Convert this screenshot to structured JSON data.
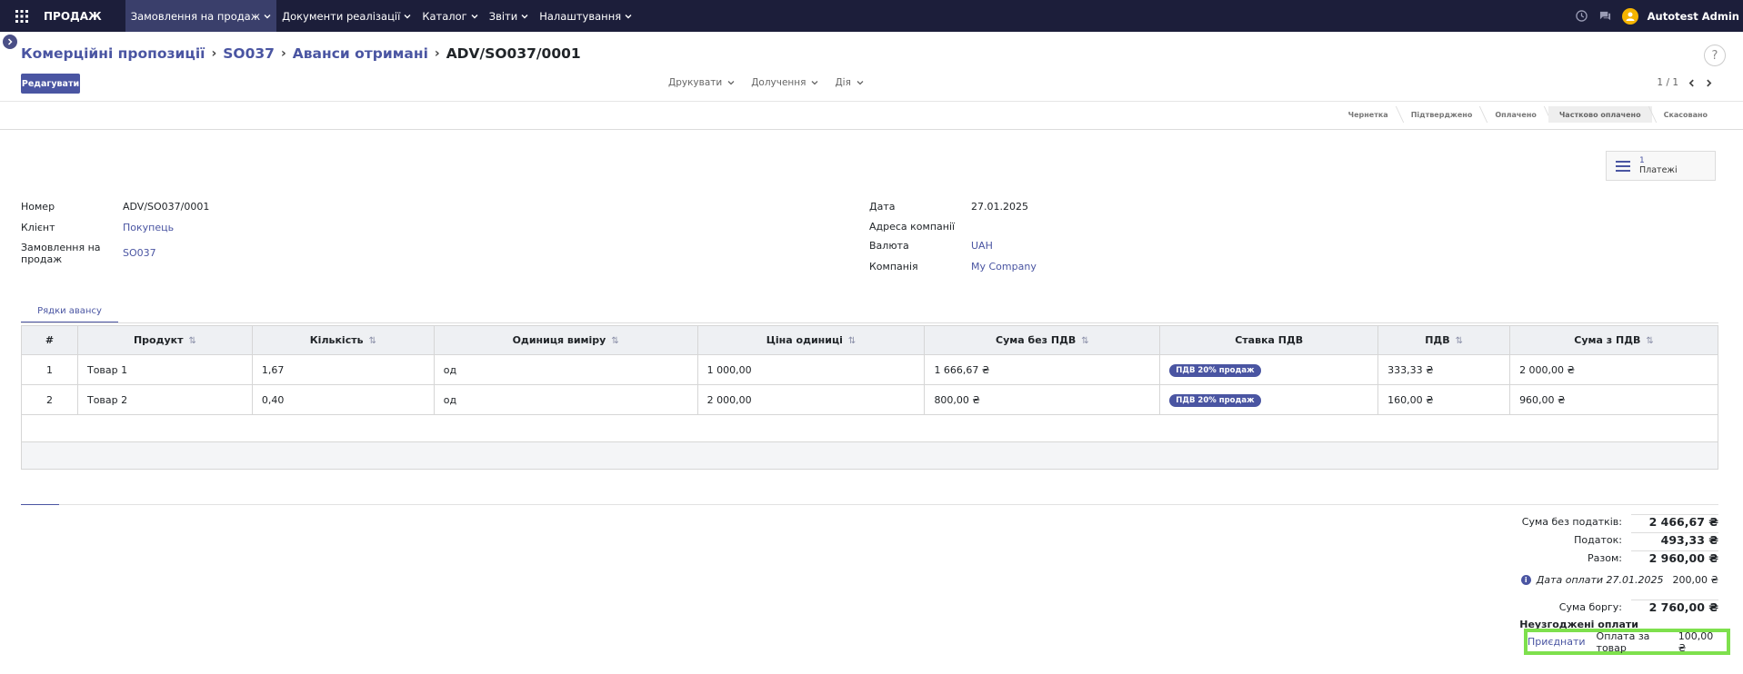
{
  "topnav": {
    "app_name": "ПРОДАЖ",
    "menu": [
      {
        "label": "Замовлення на продаж",
        "active": true
      },
      {
        "label": "Документи реалізації",
        "active": false
      },
      {
        "label": "Каталог",
        "active": false
      },
      {
        "label": "Звіти",
        "active": false
      },
      {
        "label": "Налаштування",
        "active": false
      }
    ],
    "user_name": "Autotest Admin",
    "icons": [
      "apps-grid-icon",
      "clock-icon",
      "chat-icon",
      "user-avatar-icon"
    ]
  },
  "breadcrumb": {
    "items": [
      "Комерційні пропозиції",
      "SO037",
      "Аванси отримані"
    ],
    "current": "ADV/SO037/0001"
  },
  "help": "?",
  "edit_button": "Редагувати",
  "actions": {
    "print": "Друкувати",
    "attachments": "Долучення",
    "action": "Дія"
  },
  "pager": {
    "value": "1 / 1"
  },
  "stages": [
    {
      "label": "Чернетка",
      "current": false
    },
    {
      "label": "Підтверджено",
      "current": false
    },
    {
      "label": "Оплачено",
      "current": false
    },
    {
      "label": "Частково оплачено",
      "current": true
    },
    {
      "label": "Скасовано",
      "current": false
    }
  ],
  "smart_button": {
    "count": "1",
    "label": "Платежі"
  },
  "fields_left": [
    {
      "label": "Номер",
      "value": "ADV/SO037/0001",
      "link": false
    },
    {
      "label": "Клієнт",
      "value": "Покупець",
      "link": true
    },
    {
      "label": "Замовлення на продаж",
      "value": "SO037",
      "link": true
    }
  ],
  "fields_right": [
    {
      "label": "Дата",
      "value": "27.01.2025",
      "link": false
    },
    {
      "label": "Адреса компанії",
      "value": "",
      "link": false
    },
    {
      "label": "Валюта",
      "value": "UAH",
      "link": true
    },
    {
      "label": "Компанія",
      "value": "My Company",
      "link": true
    }
  ],
  "tab": "Рядки авансу",
  "table": {
    "headers": [
      "#",
      "Продукт",
      "Кількість",
      "Одиниця виміру",
      "Ціна одиниці",
      "Сума без ПДВ",
      "Ставка ПДВ",
      "ПДВ",
      "Сума з ПДВ"
    ],
    "rows": [
      {
        "n": "1",
        "product": "Товар 1",
        "qty": "1,67",
        "uom": "од",
        "price": "1 000,00",
        "subtotal": "1 666,67 ₴",
        "tax": "ПДВ 20% продаж",
        "vat": "333,33 ₴",
        "total": "2 000,00 ₴"
      },
      {
        "n": "2",
        "product": "Товар 2",
        "qty": "0,40",
        "uom": "од",
        "price": "2 000,00",
        "subtotal": "800,00 ₴",
        "tax": "ПДВ 20% продаж",
        "vat": "160,00 ₴",
        "total": "960,00 ₴"
      }
    ]
  },
  "totals": {
    "untaxed_label": "Сума без податків:",
    "untaxed": "2 466,67 ₴",
    "tax_label": "Податок:",
    "tax": "493,33 ₴",
    "total_label": "Разом:",
    "total": "2 960,00 ₴",
    "payment_date": "Дата оплати 27.01.2025",
    "payment_amount": "200,00 ₴",
    "due_label": "Сума боргу:",
    "due": "2 760,00 ₴",
    "outstanding_title": "Неузгоджені оплати",
    "assign_label": "Приєднати",
    "outstanding_name": "Оплата за товар",
    "outstanding_amount": "100,00 ₴"
  },
  "colors": {
    "accent": "#4a55a2",
    "topnav": "#1c1e3a",
    "highlight": "#7ee04d"
  }
}
